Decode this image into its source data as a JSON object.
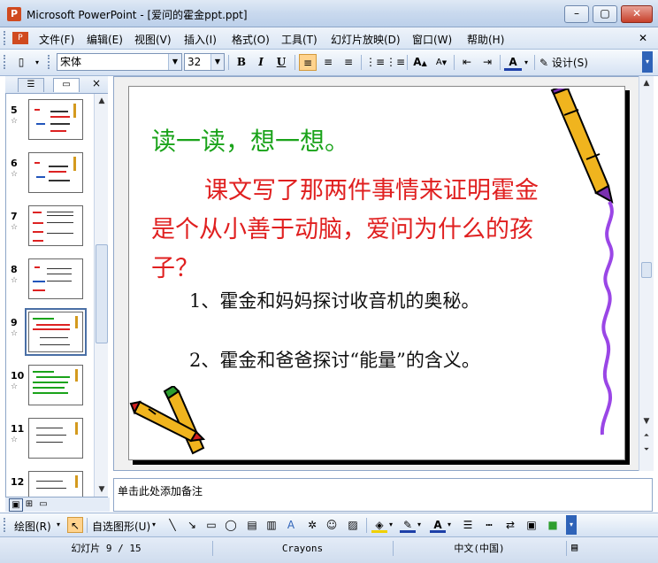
{
  "window": {
    "app": "Microsoft PowerPoint",
    "title": "Microsoft PowerPoint - [爱问的霍金ppt.ppt]",
    "controls": [
      "minimize",
      "maximize",
      "close"
    ]
  },
  "menu": {
    "items": [
      {
        "label": "文件(F)"
      },
      {
        "label": "编辑(E)"
      },
      {
        "label": "视图(V)"
      },
      {
        "label": "插入(I)"
      },
      {
        "label": "格式(O)"
      },
      {
        "label": "工具(T)"
      },
      {
        "label": "幻灯片放映(D)"
      },
      {
        "label": "窗口(W)"
      },
      {
        "label": "帮助(H)"
      }
    ]
  },
  "toolbar": {
    "font_name": "宋体",
    "font_size": "32",
    "bold": "B",
    "italic": "I",
    "underline": "U",
    "design_label": "设计(S)"
  },
  "outline_pane": {
    "tabs": [
      "outline-tab",
      "slides-tab"
    ],
    "close": "×",
    "slide_numbers": [
      "5",
      "6",
      "7",
      "8",
      "9",
      "10",
      "11",
      "12"
    ],
    "selected": 9
  },
  "slide": {
    "heading": "读一读，想一想。",
    "question": "课文写了那两件事情来证明霍金是个从小善于动脑，爱问为什么的孩子？",
    "point1": "1、霍金和妈妈探讨收音机的奥秘。",
    "point2": "2、霍金和爸爸探讨“能量”的含义。",
    "colors": {
      "heading": "#1aa31a",
      "question": "#e02020",
      "points": "#111111"
    }
  },
  "notes": {
    "placeholder": "单击此处添加备注"
  },
  "drawing_toolbar": {
    "draw_label": "绘图(R)",
    "autoshapes_label": "自选图形(U)"
  },
  "status": {
    "slide_position": "幻灯片 9 / 15",
    "design_name": "Crayons",
    "language": "中文(中国)"
  }
}
